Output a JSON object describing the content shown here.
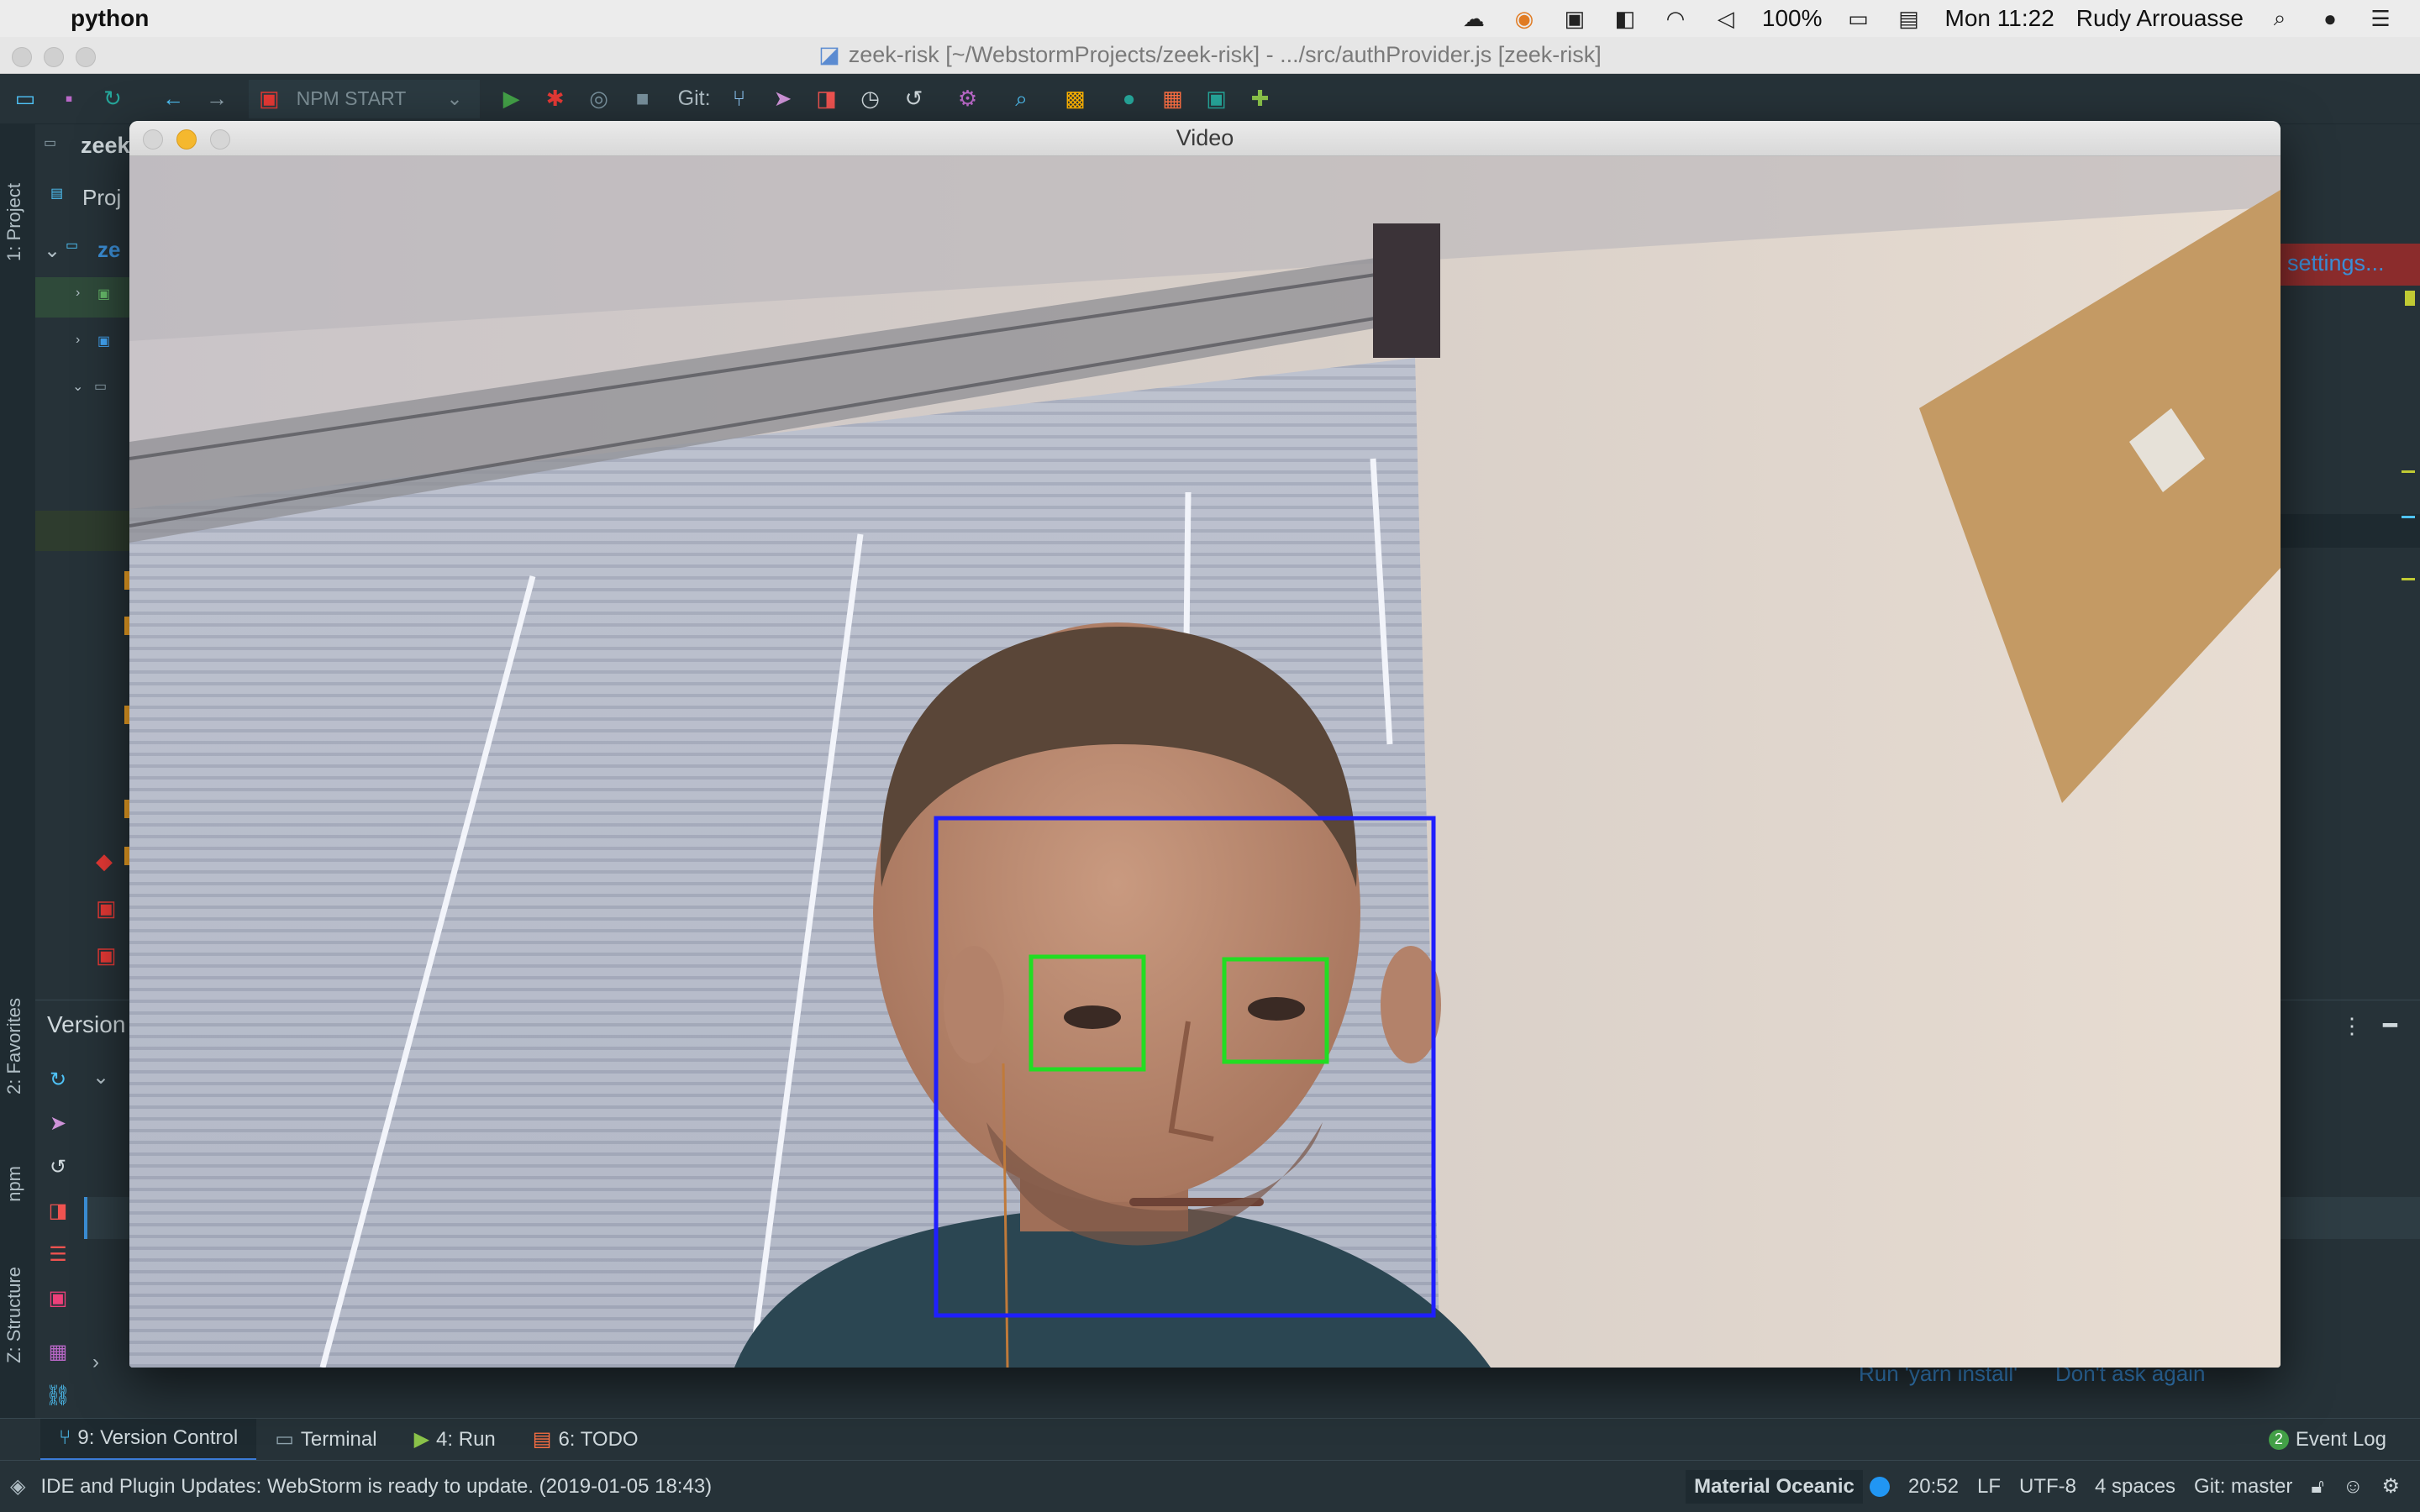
{
  "menubar": {
    "app_name": "python",
    "battery": "100%",
    "clock": "Mon 11:22",
    "user": "Rudy Arrouasse"
  },
  "window": {
    "title": "zeek-risk [~/WebstormProjects/zeek-risk] - .../src/authProvider.js [zeek-risk]"
  },
  "toolbar": {
    "run_config": "NPM START",
    "git_label": "Git:"
  },
  "project": {
    "name_truncated": "zeek-ris",
    "tab_truncated": "Proj",
    "root_truncated": "ze"
  },
  "video_window": {
    "title": "Video"
  },
  "editor": {
    "settings_link": "settings..."
  },
  "version_control": {
    "header": "Version"
  },
  "notification": {
    "run_yarn": "Run 'yarn install'",
    "dont_ask": "Don't ask again"
  },
  "left_strip": {
    "project": "1: Project",
    "favorites": "2: Favorites",
    "npm": "npm",
    "structure": "Z: Structure"
  },
  "bottom_tabs": [
    {
      "label": "9: Version Control",
      "icon": "branch-icon"
    },
    {
      "label": "Terminal",
      "icon": "terminal-icon"
    },
    {
      "label": "4: Run",
      "icon": "run-icon"
    },
    {
      "label": "6: TODO",
      "icon": "todo-icon"
    }
  ],
  "event_log": {
    "count": "2",
    "label": "Event Log"
  },
  "statusbar": {
    "message": "IDE and Plugin Updates: WebStorm is ready to update. (2019-01-05 18:43)",
    "theme": "Material Oceanic",
    "position": "20:52",
    "line_sep": "LF",
    "encoding": "UTF-8",
    "indent": "4 spaces",
    "git_branch": "Git: master"
  },
  "colors": {
    "face_box": "#1f1fff",
    "eye_box": "#22dd22",
    "ide_bg": "#263238",
    "accent": "#3b8ed6"
  }
}
